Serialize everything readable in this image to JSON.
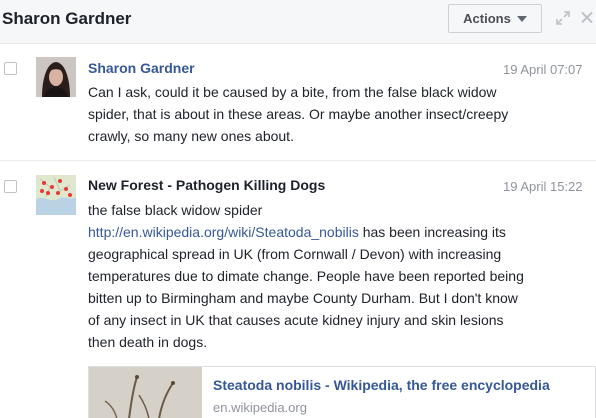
{
  "header": {
    "title": "Sharon Gardner",
    "actions_label": "Actions",
    "icons": {
      "expand": "expand-icon",
      "close": "close-icon",
      "caret": "caret-down-icon"
    }
  },
  "messages": [
    {
      "sender": "Sharon Gardner",
      "date": "19 April 07:07",
      "lines": [
        "Can I ask, could it be caused by a bite, from the false black widow",
        "spider, that is about in these areas. Or maybe another insect/creepy",
        "crawly, so many new ones about."
      ]
    },
    {
      "sender": "New Forest - Pathogen Killing Dogs",
      "date": "19 April 15:22",
      "line1": "the false black widow  spider",
      "link": "http://en.wikipedia.org/wiki/Steatoda_nobilis",
      "line2_rest": " has been increasing its",
      "lines": [
        "geographical spread in UK (from Cornwall / Devon) with increasing",
        "temperatures due to dimate change. People have been reported being",
        "bitten up to Birmingham and maybe County Durham. But I don't know",
        "of any insect in UK that causes acute kidney injury and skin lesions",
        "then death in dogs."
      ],
      "preview": {
        "title": "Steatoda nobilis - Wikipedia, the free encyclopedia",
        "domain": "en.wikipedia.org"
      }
    }
  ],
  "colors": {
    "link": "#365899",
    "date": "#90949c",
    "text": "#1d2129",
    "header_bg": "#f6f7f9"
  }
}
